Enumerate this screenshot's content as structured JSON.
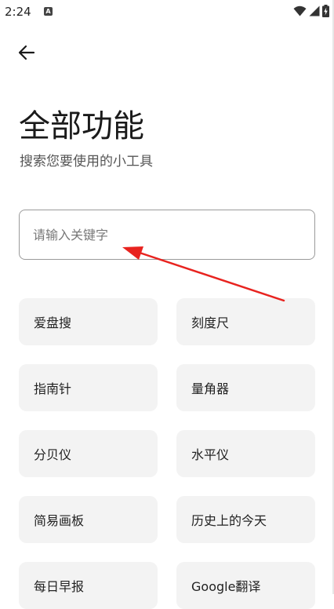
{
  "status_bar": {
    "time": "2:24",
    "notification_letter": "A"
  },
  "header": {
    "title": "全部功能",
    "subtitle": "搜索您要使用的小工具"
  },
  "search": {
    "placeholder": "请输入关键字",
    "value": ""
  },
  "tools": [
    {
      "label": "爱盘搜"
    },
    {
      "label": "刻度尺"
    },
    {
      "label": "指南针"
    },
    {
      "label": "量角器"
    },
    {
      "label": "分贝仪"
    },
    {
      "label": "水平仪"
    },
    {
      "label": "简易画板"
    },
    {
      "label": "历史上的今天"
    },
    {
      "label": "每日早报"
    },
    {
      "label": "Google翻译"
    }
  ],
  "colors": {
    "annotation_arrow": "#e8231f",
    "card_background": "#f3f3f3",
    "input_border": "#9a9a9a"
  }
}
